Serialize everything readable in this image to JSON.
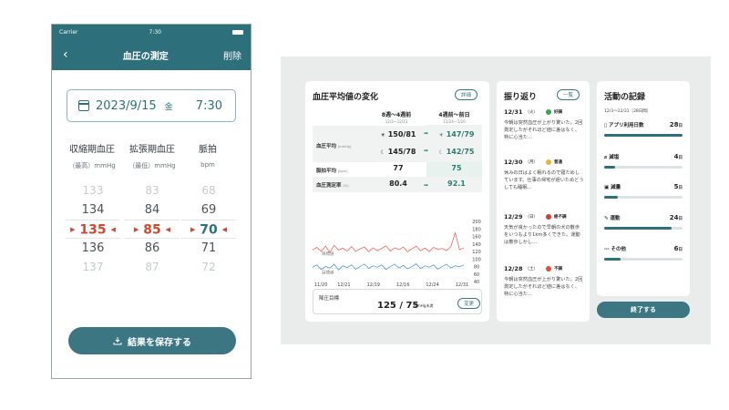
{
  "phone": {
    "status": {
      "carrier": "Carrier",
      "time": "7:30"
    },
    "appbar": {
      "back": "‹",
      "title": "血圧の測定",
      "delete": "削除"
    },
    "date": {
      "date": "2023/9/15",
      "dow": "金",
      "time": "7:30"
    },
    "columns": [
      {
        "label": "収縮期血圧",
        "sub": "（最高）mmHg"
      },
      {
        "label": "拡張期血圧",
        "sub": "（最低）mmHg"
      },
      {
        "label": "脈拍",
        "sub": "bpm"
      }
    ],
    "pickers": {
      "systolic": [
        "133",
        "134",
        "135",
        "136",
        "137"
      ],
      "diastolic": [
        "83",
        "84",
        "85",
        "86",
        "87"
      ],
      "pulse": [
        "68",
        "69",
        "70",
        "71",
        "72"
      ]
    },
    "save_button": "結果を保存する"
  },
  "avg_card": {
    "title": "血圧平均値の変化",
    "detail_button": "詳細",
    "col1": {
      "label": "8週～4週前",
      "range": "12/3～12/23"
    },
    "col2": {
      "label": "4週前～前日",
      "range": "12/24～1/20"
    },
    "rows": {
      "bp_label": "血圧平均",
      "bp_unit": "[mmHg]",
      "bp_morning_1": "150/81",
      "bp_evening_1": "145/78",
      "bp_morning_2": "147/79",
      "bp_evening_2": "142/75",
      "pulse_label": "脈拍平均",
      "pulse_unit": "[bpm]",
      "pulse_1": "77",
      "pulse_2": "75",
      "rate_label": "血圧測定率",
      "rate_unit": "[%]",
      "rate_1": "80.4",
      "rate_2": "92.1"
    },
    "goal": {
      "label": "降圧目標",
      "value": "125 / 75",
      "unit": "mmHg未満",
      "button": "変更"
    }
  },
  "chart_data": {
    "type": "line",
    "x_labels": [
      "11/20",
      "12/21",
      "12/19",
      "12/16",
      "12/24",
      "12/31"
    ],
    "y_ticks": [
      200,
      180,
      160,
      140,
      120,
      100,
      80,
      60,
      40
    ],
    "ylim": [
      40,
      200
    ],
    "series": [
      {
        "color": "#e9564f",
        "values": [
          124,
          131,
          120,
          134,
          118,
          136,
          124,
          129,
          121,
          133,
          120,
          127,
          132,
          119,
          130,
          122,
          128,
          135,
          121,
          130,
          125,
          132,
          119,
          127,
          134,
          122,
          129,
          120,
          131,
          126,
          128,
          122,
          133,
          170,
          125,
          130
        ]
      },
      {
        "color": "#3a86c9",
        "values": [
          78,
          84,
          72,
          80,
          76,
          86,
          71,
          82,
          77,
          84,
          73,
          80,
          86,
          75,
          82,
          78,
          84,
          72,
          80,
          86,
          76,
          83,
          74,
          80,
          87,
          75,
          82,
          78,
          84,
          73,
          80,
          86,
          76,
          82,
          79,
          84
        ]
      }
    ],
    "goal_lines": [
      {
        "label": "目標値",
        "value": 125
      },
      {
        "label": "目標値",
        "value": 75
      }
    ]
  },
  "review": {
    "title": "振り返り",
    "list_button": "一覧",
    "entries": [
      {
        "date": "12/31",
        "dow": "（火）",
        "mood": "好調",
        "color": "#3da24a",
        "text": "今朝は突然血圧が上がり驚いた。2回測定したがそれほど値に差はなく、特に心当た…"
      },
      {
        "date": "12/30",
        "dow": "（月）",
        "mood": "普通",
        "color": "#e6b62c",
        "text": "休みの日はよく眠れるので寝ためしています。仕事の帰宅が遅いためどうしても睡眠…"
      },
      {
        "date": "12/29",
        "dow": "（日）",
        "mood": "絶不調",
        "color": "#d93a2e",
        "text": "天気が良かったので早朝の犬の散歩をいつもより1km多くできた。運動は散歩しかし…"
      },
      {
        "date": "12/28",
        "dow": "（土）",
        "mood": "不調",
        "color": "#e0502e",
        "text": "今朝は突然血圧が上がり驚いた。2回測定したがそれほど値に差はなく、特に心当た…"
      }
    ]
  },
  "activity": {
    "title": "活動の記録",
    "period": "12/3～12/31（28日間）",
    "rows": [
      {
        "label": "アプリ利用日数",
        "icon": "phone-icon",
        "glyph": "▯",
        "num": "28",
        "unit": "日",
        "fraction": 1.0
      },
      {
        "label": "減塩",
        "icon": "salt-icon",
        "glyph": "⌀",
        "num": "4",
        "unit": "日",
        "fraction": 0.14
      },
      {
        "label": "減量",
        "icon": "scale-icon",
        "glyph": "▣",
        "num": "5",
        "unit": "日",
        "fraction": 0.18
      },
      {
        "label": "運動",
        "icon": "run-icon",
        "glyph": "✎",
        "num": "24",
        "unit": "日",
        "fraction": 0.86
      },
      {
        "label": "その他",
        "icon": "more-icon",
        "glyph": "⋯",
        "num": "6",
        "unit": "日",
        "fraction": 0.21
      }
    ],
    "end_button": "終了する"
  },
  "colors": {
    "teal": "#2e6f7c",
    "accent_red": "#cf4a2f",
    "bg": "#eaecec"
  }
}
